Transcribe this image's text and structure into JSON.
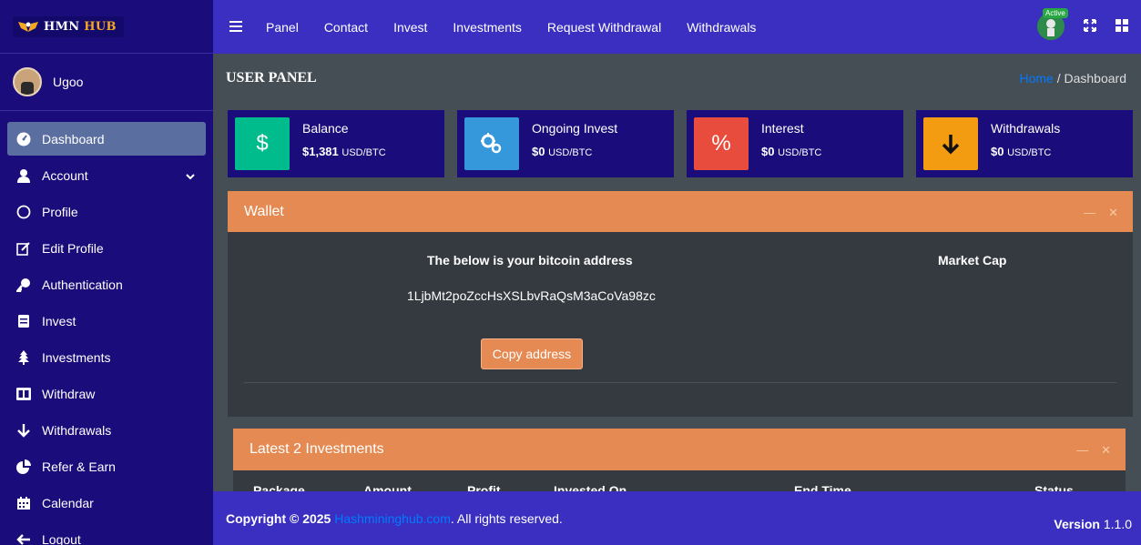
{
  "brand": {
    "name_part1": "HMN",
    "name_part2": "HUB"
  },
  "user": {
    "name": "Ugoo"
  },
  "sidebar": {
    "items": [
      {
        "label": "Dashboard",
        "icon": "dashboard-icon",
        "active": true
      },
      {
        "label": "Account",
        "icon": "user-icon",
        "has_caret": true
      },
      {
        "label": "Profile",
        "icon": "circle-icon"
      },
      {
        "label": "Edit Profile",
        "icon": "edit-icon"
      },
      {
        "label": "Authentication",
        "icon": "key-icon"
      },
      {
        "label": "Invest",
        "icon": "invoice-icon"
      },
      {
        "label": "Investments",
        "icon": "tree-icon"
      },
      {
        "label": "Withdraw",
        "icon": "columns-icon"
      },
      {
        "label": "Withdrawals",
        "icon": "arrow-down-icon"
      },
      {
        "label": "Refer & Earn",
        "icon": "pie-icon"
      },
      {
        "label": "Calendar",
        "icon": "calendar-icon"
      },
      {
        "label": "Logout",
        "icon": "arrow-left-icon"
      }
    ]
  },
  "topnav": {
    "items": [
      "Panel",
      "Contact",
      "Invest",
      "Investments",
      "Request Withdrawal",
      "Withdrawals"
    ]
  },
  "status": {
    "badge": "Active"
  },
  "page": {
    "title": "USER PANEL"
  },
  "breadcrumb": {
    "home": "Home",
    "separator": "/",
    "current": "Dashboard"
  },
  "stats": [
    {
      "label": "Balance",
      "amount": "$1,381",
      "unit": "USD/BTC",
      "icon": "dollar-icon",
      "color": "#00bc8c"
    },
    {
      "label": "Ongoing Invest",
      "amount": "$0",
      "unit": "USD/BTC",
      "icon": "cogs-icon",
      "color": "#3498db"
    },
    {
      "label": "Interest",
      "amount": "$0",
      "unit": "USD/BTC",
      "icon": "percent-icon",
      "color": "#e74c3c"
    },
    {
      "label": "Withdrawals",
      "amount": "$0",
      "unit": "USD/BTC",
      "icon": "arrow-down-icon",
      "color": "#f39c12"
    }
  ],
  "wallet": {
    "title": "Wallet",
    "address_heading": "The below is your bitcoin address",
    "address": "1LjbMt2poZccHsXSLbvRaQsM3aCoVa98zc",
    "market_heading": "Market Cap",
    "copy_label": "Copy address"
  },
  "investments": {
    "title": "Latest 2 Investments",
    "columns": [
      "Package",
      "Amount",
      "Profit",
      "Invested On",
      "End Time",
      "Status"
    ]
  },
  "footer": {
    "copyright_prefix": "Copyright © 2025 ",
    "site": "Hashmininghub.com",
    "suffix": ". All rights reserved.",
    "version_label": "Version",
    "version": "1.1.0"
  },
  "colors": {
    "sidebar": "#1a0c7a",
    "topbar": "#3a2fc0",
    "accent": "#e58a52",
    "content": "#454d55",
    "card": "#343a40"
  }
}
